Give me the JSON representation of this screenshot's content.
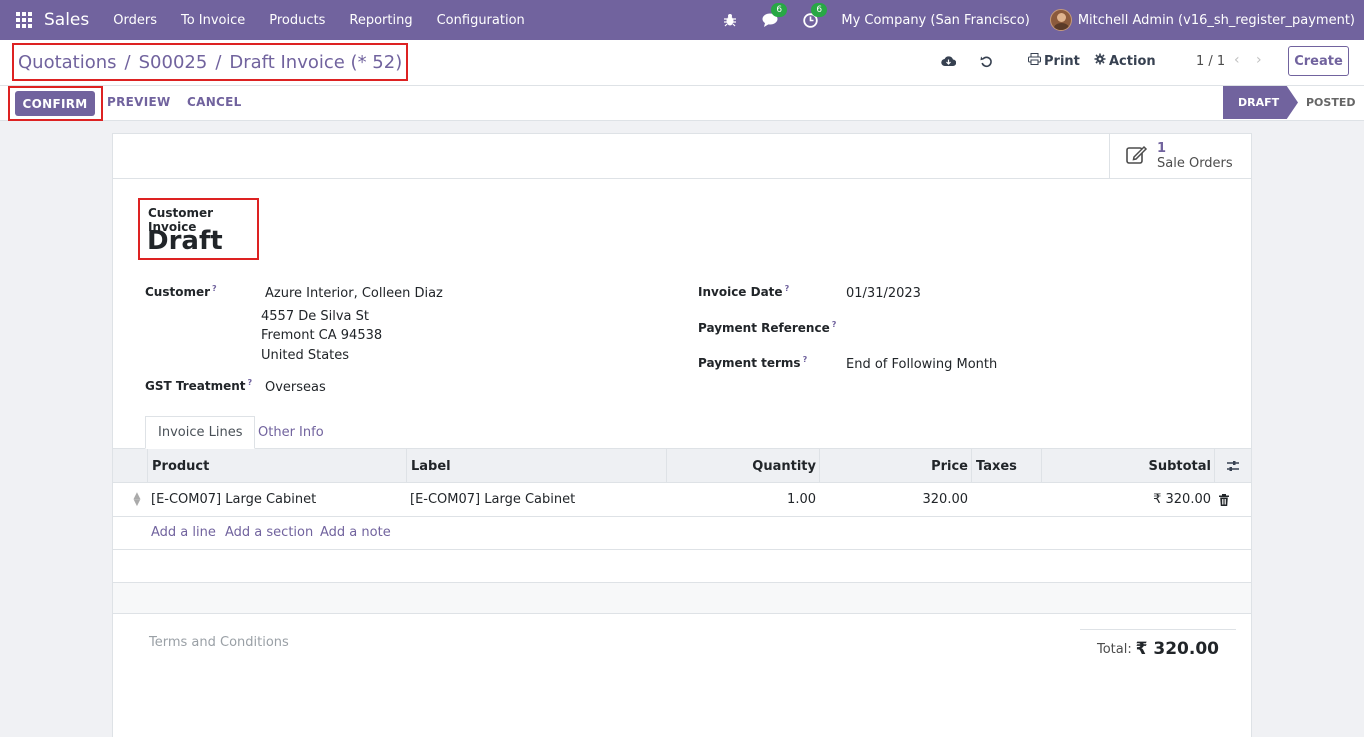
{
  "navbar": {
    "brand": "Sales",
    "menu": [
      "Orders",
      "To Invoice",
      "Products",
      "Reporting",
      "Configuration"
    ],
    "messages_count": "6",
    "activities_count": "6",
    "company": "My Company (San Francisco)",
    "user": "Mitchell Admin (v16_sh_register_payment)"
  },
  "breadcrumb": {
    "root": "Quotations",
    "sep": "/",
    "order": "S00025",
    "current": "Draft Invoice (* 52)"
  },
  "control": {
    "print_label": "Print",
    "action_label": "Action",
    "pager": "1 / 1",
    "create_label": "Create"
  },
  "statusbar": {
    "confirm_label": "CONFIRM",
    "preview_label": "PREVIEW",
    "cancel_label": "CANCEL",
    "stages": [
      "DRAFT",
      "POSTED"
    ]
  },
  "smart_button": {
    "count": "1",
    "label": "Sale Orders"
  },
  "invoice": {
    "type_label": "Customer Invoice",
    "state": "Draft",
    "customer_label": "Customer",
    "customer_name": "Azure Interior, Colleen Diaz",
    "address_line1": "4557 De Silva St",
    "address_line2": "Fremont CA 94538",
    "address_line3": "United States",
    "gst_label": "GST Treatment",
    "gst_value": "Overseas",
    "invoice_date_label": "Invoice Date",
    "invoice_date": "01/31/2023",
    "payment_ref_label": "Payment Reference",
    "payment_terms_label": "Payment terms",
    "payment_terms": "End of Following Month",
    "help_mark": "?"
  },
  "tabs": {
    "invoice_lines": "Invoice Lines",
    "other_info": "Other Info"
  },
  "table": {
    "headers": {
      "product": "Product",
      "label": "Label",
      "quantity": "Quantity",
      "price": "Price",
      "taxes": "Taxes",
      "subtotal": "Subtotal"
    },
    "rows": [
      {
        "product": "[E-COM07] Large Cabinet",
        "label": "[E-COM07] Large Cabinet",
        "quantity": "1.00",
        "price": "320.00",
        "taxes": "",
        "subtotal": "₹ 320.00"
      }
    ],
    "add_line": "Add a line",
    "add_section": "Add a section",
    "add_note": "Add a note"
  },
  "footer": {
    "terms_placeholder": "Terms and Conditions",
    "total_label": "Total:",
    "total_value": "₹ 320.00"
  }
}
